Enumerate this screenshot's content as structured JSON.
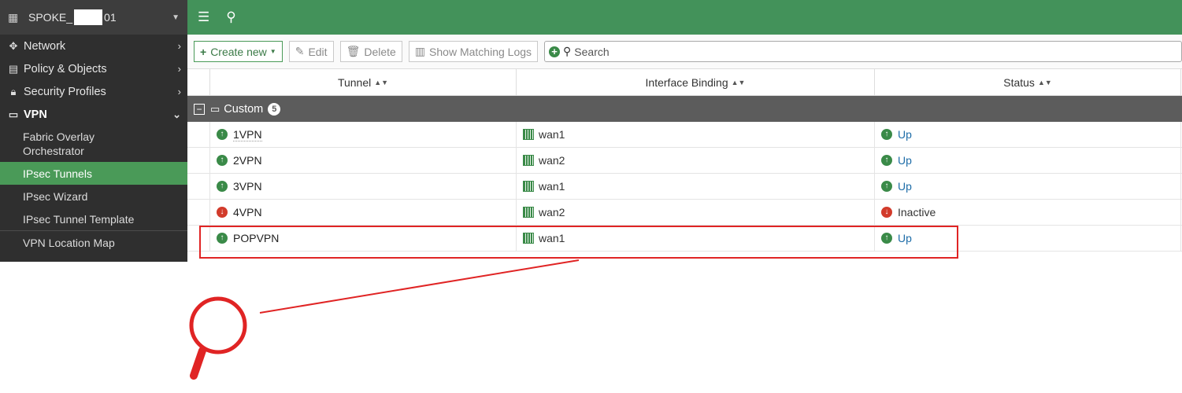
{
  "sidebar": {
    "device_prefix": "SPOKE_",
    "device_suffix": "01",
    "items": [
      {
        "label": "Network",
        "icon": "network-icon"
      },
      {
        "label": "Policy & Objects",
        "icon": "policy-icon"
      },
      {
        "label": "Security Profiles",
        "icon": "lock-icon"
      },
      {
        "label": "VPN",
        "icon": "vpn-icon"
      }
    ],
    "vpn_sub": [
      "Fabric Overlay Orchestrator",
      "IPsec Tunnels",
      "IPsec Wizard",
      "IPsec Tunnel Template"
    ],
    "vpn_map": "VPN Location Map"
  },
  "toolbar": {
    "create_new": "Create new",
    "edit": "Edit",
    "delete": "Delete",
    "show_logs": "Show Matching Logs",
    "search_placeholder": "Search"
  },
  "table": {
    "headers": [
      "Tunnel",
      "Interface Binding",
      "Status"
    ],
    "group": {
      "label": "Custom",
      "count": "5"
    },
    "rows": [
      {
        "tunnel": "1VPN",
        "interface": "wan1",
        "status": "Up",
        "state": "up"
      },
      {
        "tunnel": "2VPN",
        "interface": "wan2",
        "status": "Up",
        "state": "up"
      },
      {
        "tunnel": "3VPN",
        "interface": "wan1",
        "status": "Up",
        "state": "up"
      },
      {
        "tunnel": "4VPN",
        "interface": "wan2",
        "status": "Inactive",
        "state": "down"
      },
      {
        "tunnel": "POPVPN",
        "interface": "wan1",
        "status": "Up",
        "state": "up"
      }
    ]
  },
  "colors": {
    "accent": "#43925a",
    "sidebar": "#2f2f2f",
    "highlight": "#e02424",
    "up": "#3a8a48",
    "down": "#d23b2b"
  }
}
